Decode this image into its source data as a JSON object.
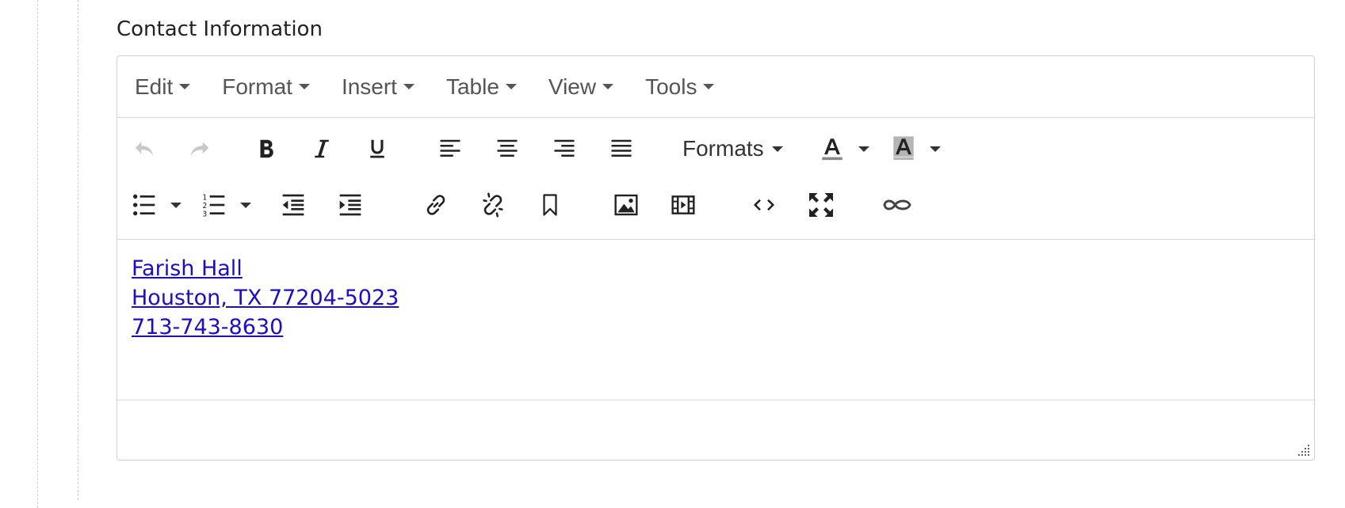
{
  "field": {
    "label": "Contact Information"
  },
  "menubar": {
    "items": [
      {
        "label": "Edit"
      },
      {
        "label": "Format"
      },
      {
        "label": "Insert"
      },
      {
        "label": "Table"
      },
      {
        "label": "View"
      },
      {
        "label": "Tools"
      }
    ]
  },
  "toolbar": {
    "formats_label": "Formats",
    "icons": {
      "undo": "undo-icon",
      "redo": "redo-icon",
      "bold": "bold-icon",
      "italic": "italic-icon",
      "underline": "underline-icon",
      "align_left": "align-left-icon",
      "align_center": "align-center-icon",
      "align_right": "align-right-icon",
      "justify": "justify-icon",
      "text_color": "text-color-icon",
      "background_color": "background-color-icon",
      "bullet_list": "bullet-list-icon",
      "numbered_list": "numbered-list-icon",
      "outdent": "outdent-icon",
      "indent": "indent-icon",
      "link": "link-icon",
      "unlink": "unlink-icon",
      "anchor": "bookmark-icon",
      "image": "image-icon",
      "media": "film-icon",
      "code": "code-icon",
      "fullscreen": "fullscreen-icon",
      "chain": "infinity-link-icon"
    }
  },
  "content": {
    "lines": [
      "Farish Hall",
      "Houston, TX 77204-5023",
      "713-743-8630"
    ]
  },
  "colors": {
    "link": "#1a0dcc",
    "border": "#cfcfd6",
    "disabled_icon": "#c8c8c8",
    "icon": "#222222",
    "highlight": "#b5b5b5"
  }
}
